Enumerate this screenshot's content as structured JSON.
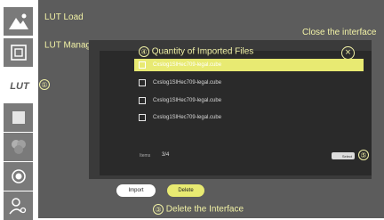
{
  "sidebar": {
    "lut_label": "LUT",
    "icons": [
      "mountain-icon",
      "frame-icon",
      "square-icon",
      "color-circles-icon",
      "record-icon",
      "user-settings-icon"
    ]
  },
  "menu": {
    "lut_load": "LUT Load",
    "lut_manage": "LUT Manage"
  },
  "annotations": {
    "one": "①",
    "two": "②",
    "three": "③",
    "four": "④",
    "five": "⑤",
    "close_interface": "Close the interface",
    "quantity_imported": "Quantity of Imported Files",
    "delete_interface": "Delete the Interface"
  },
  "dialog": {
    "files": [
      {
        "name": "Cxslog1SlHec709-legal.cube",
        "selected": true
      },
      {
        "name": "Cxslog1SlHec709-legal.cube",
        "selected": false
      },
      {
        "name": "Cxslog1SlHec709-legal.cube",
        "selected": false
      },
      {
        "name": "Cxslog1SlHec709-legal.cube",
        "selected": false
      }
    ],
    "count_label": "Items",
    "count_value": "3/4",
    "close_symbol": "×",
    "toggle_label": "Select"
  },
  "buttons": {
    "import": "Import",
    "delete": "Delete"
  },
  "colors": {
    "panel_bg": "#5c5c5c",
    "accent_yellow": "#e8ea72",
    "annotation_text": "#f2f2a6",
    "sidebar_button": "#7a7a7a"
  }
}
